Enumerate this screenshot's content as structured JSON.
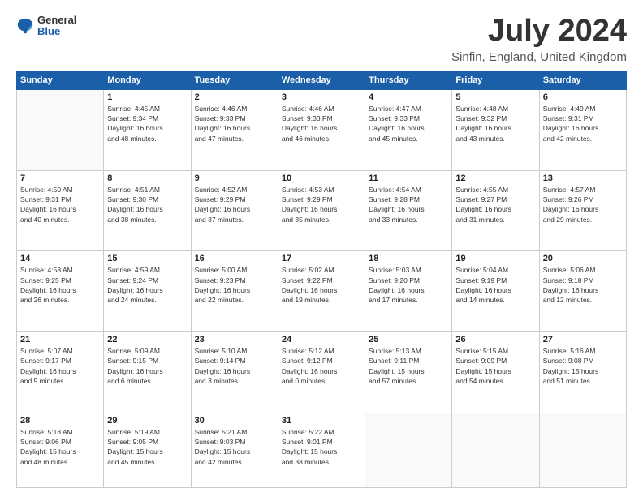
{
  "logo": {
    "general": "General",
    "blue": "Blue"
  },
  "title": "July 2024",
  "subtitle": "Sinfin, England, United Kingdom",
  "days_header": [
    "Sunday",
    "Monday",
    "Tuesday",
    "Wednesday",
    "Thursday",
    "Friday",
    "Saturday"
  ],
  "weeks": [
    [
      {
        "day": "",
        "info": ""
      },
      {
        "day": "1",
        "info": "Sunrise: 4:45 AM\nSunset: 9:34 PM\nDaylight: 16 hours\nand 48 minutes."
      },
      {
        "day": "2",
        "info": "Sunrise: 4:46 AM\nSunset: 9:33 PM\nDaylight: 16 hours\nand 47 minutes."
      },
      {
        "day": "3",
        "info": "Sunrise: 4:46 AM\nSunset: 9:33 PM\nDaylight: 16 hours\nand 46 minutes."
      },
      {
        "day": "4",
        "info": "Sunrise: 4:47 AM\nSunset: 9:33 PM\nDaylight: 16 hours\nand 45 minutes."
      },
      {
        "day": "5",
        "info": "Sunrise: 4:48 AM\nSunset: 9:32 PM\nDaylight: 16 hours\nand 43 minutes."
      },
      {
        "day": "6",
        "info": "Sunrise: 4:49 AM\nSunset: 9:31 PM\nDaylight: 16 hours\nand 42 minutes."
      }
    ],
    [
      {
        "day": "7",
        "info": "Sunrise: 4:50 AM\nSunset: 9:31 PM\nDaylight: 16 hours\nand 40 minutes."
      },
      {
        "day": "8",
        "info": "Sunrise: 4:51 AM\nSunset: 9:30 PM\nDaylight: 16 hours\nand 38 minutes."
      },
      {
        "day": "9",
        "info": "Sunrise: 4:52 AM\nSunset: 9:29 PM\nDaylight: 16 hours\nand 37 minutes."
      },
      {
        "day": "10",
        "info": "Sunrise: 4:53 AM\nSunset: 9:29 PM\nDaylight: 16 hours\nand 35 minutes."
      },
      {
        "day": "11",
        "info": "Sunrise: 4:54 AM\nSunset: 9:28 PM\nDaylight: 16 hours\nand 33 minutes."
      },
      {
        "day": "12",
        "info": "Sunrise: 4:55 AM\nSunset: 9:27 PM\nDaylight: 16 hours\nand 31 minutes."
      },
      {
        "day": "13",
        "info": "Sunrise: 4:57 AM\nSunset: 9:26 PM\nDaylight: 16 hours\nand 29 minutes."
      }
    ],
    [
      {
        "day": "14",
        "info": "Sunrise: 4:58 AM\nSunset: 9:25 PM\nDaylight: 16 hours\nand 26 minutes."
      },
      {
        "day": "15",
        "info": "Sunrise: 4:59 AM\nSunset: 9:24 PM\nDaylight: 16 hours\nand 24 minutes."
      },
      {
        "day": "16",
        "info": "Sunrise: 5:00 AM\nSunset: 9:23 PM\nDaylight: 16 hours\nand 22 minutes."
      },
      {
        "day": "17",
        "info": "Sunrise: 5:02 AM\nSunset: 9:22 PM\nDaylight: 16 hours\nand 19 minutes."
      },
      {
        "day": "18",
        "info": "Sunrise: 5:03 AM\nSunset: 9:20 PM\nDaylight: 16 hours\nand 17 minutes."
      },
      {
        "day": "19",
        "info": "Sunrise: 5:04 AM\nSunset: 9:19 PM\nDaylight: 16 hours\nand 14 minutes."
      },
      {
        "day": "20",
        "info": "Sunrise: 5:06 AM\nSunset: 9:18 PM\nDaylight: 16 hours\nand 12 minutes."
      }
    ],
    [
      {
        "day": "21",
        "info": "Sunrise: 5:07 AM\nSunset: 9:17 PM\nDaylight: 16 hours\nand 9 minutes."
      },
      {
        "day": "22",
        "info": "Sunrise: 5:09 AM\nSunset: 9:15 PM\nDaylight: 16 hours\nand 6 minutes."
      },
      {
        "day": "23",
        "info": "Sunrise: 5:10 AM\nSunset: 9:14 PM\nDaylight: 16 hours\nand 3 minutes."
      },
      {
        "day": "24",
        "info": "Sunrise: 5:12 AM\nSunset: 9:12 PM\nDaylight: 16 hours\nand 0 minutes."
      },
      {
        "day": "25",
        "info": "Sunrise: 5:13 AM\nSunset: 9:11 PM\nDaylight: 15 hours\nand 57 minutes."
      },
      {
        "day": "26",
        "info": "Sunrise: 5:15 AM\nSunset: 9:09 PM\nDaylight: 15 hours\nand 54 minutes."
      },
      {
        "day": "27",
        "info": "Sunrise: 5:16 AM\nSunset: 9:08 PM\nDaylight: 15 hours\nand 51 minutes."
      }
    ],
    [
      {
        "day": "28",
        "info": "Sunrise: 5:18 AM\nSunset: 9:06 PM\nDaylight: 15 hours\nand 48 minutes."
      },
      {
        "day": "29",
        "info": "Sunrise: 5:19 AM\nSunset: 9:05 PM\nDaylight: 15 hours\nand 45 minutes."
      },
      {
        "day": "30",
        "info": "Sunrise: 5:21 AM\nSunset: 9:03 PM\nDaylight: 15 hours\nand 42 minutes."
      },
      {
        "day": "31",
        "info": "Sunrise: 5:22 AM\nSunset: 9:01 PM\nDaylight: 15 hours\nand 38 minutes."
      },
      {
        "day": "",
        "info": ""
      },
      {
        "day": "",
        "info": ""
      },
      {
        "day": "",
        "info": ""
      }
    ]
  ]
}
